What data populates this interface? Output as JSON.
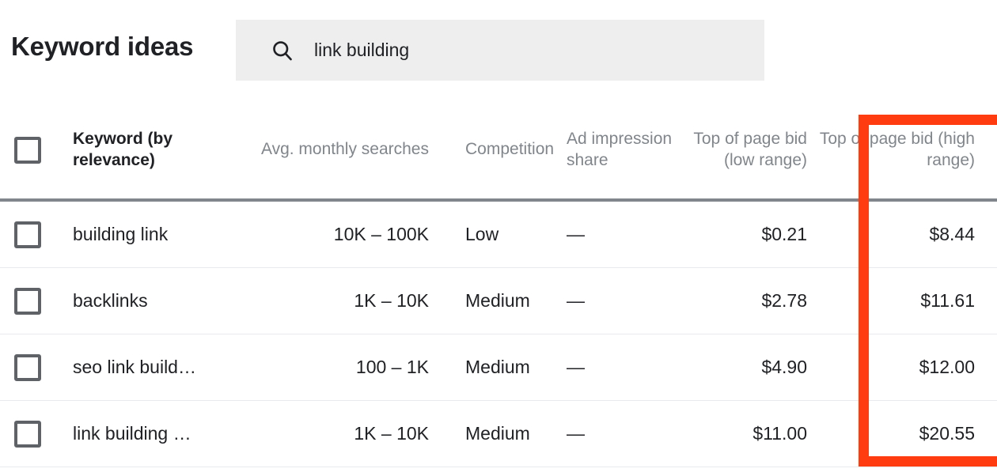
{
  "header": {
    "title": "Keyword ideas",
    "search": {
      "icon": "search-icon",
      "value": "link building",
      "placeholder": "link building"
    }
  },
  "table": {
    "columns": [
      {
        "key": "select",
        "label": "",
        "icon": "checkbox-icon",
        "align": "left"
      },
      {
        "key": "keyword",
        "label": "Keyword (by relevance)",
        "align": "left",
        "emphasis": true
      },
      {
        "key": "searches",
        "label": "Avg. monthly searches",
        "align": "right",
        "emphasis": false
      },
      {
        "key": "competition",
        "label": "Competition",
        "align": "left",
        "emphasis": false
      },
      {
        "key": "ad_impression_share",
        "label": "Ad impression share",
        "align": "left",
        "emphasis": false
      },
      {
        "key": "bid_low",
        "label": "Top of page bid (low range)",
        "align": "right",
        "emphasis": false
      },
      {
        "key": "bid_high",
        "label": "Top of page bid (high range)",
        "align": "right",
        "emphasis": false
      }
    ],
    "rows": [
      {
        "keyword": "building link",
        "searches": "10K – 100K",
        "competition": "Low",
        "ad_impression_share": "—",
        "bid_low": "$0.21",
        "bid_high": "$8.44"
      },
      {
        "keyword": "backlinks",
        "searches": "1K – 10K",
        "competition": "Medium",
        "ad_impression_share": "—",
        "bid_low": "$2.78",
        "bid_high": "$11.61"
      },
      {
        "keyword": "seo link build…",
        "searches": "100 – 1K",
        "competition": "Medium",
        "ad_impression_share": "—",
        "bid_low": "$4.90",
        "bid_high": "$12.00"
      },
      {
        "keyword": "link building …",
        "searches": "1K – 10K",
        "competition": "Medium",
        "ad_impression_share": "—",
        "bid_low": "$11.00",
        "bid_high": "$20.55"
      }
    ]
  },
  "annotation": {
    "target_column": "Top of page bid (high range)",
    "color": "#ff3c10"
  },
  "colors": {
    "search_field_background": "#eeeeee",
    "header_text": "#80868b",
    "body_text": "#202124",
    "row_divider": "#e8eaed",
    "header_divider": "#80868b",
    "highlight": "#ff3c10"
  }
}
